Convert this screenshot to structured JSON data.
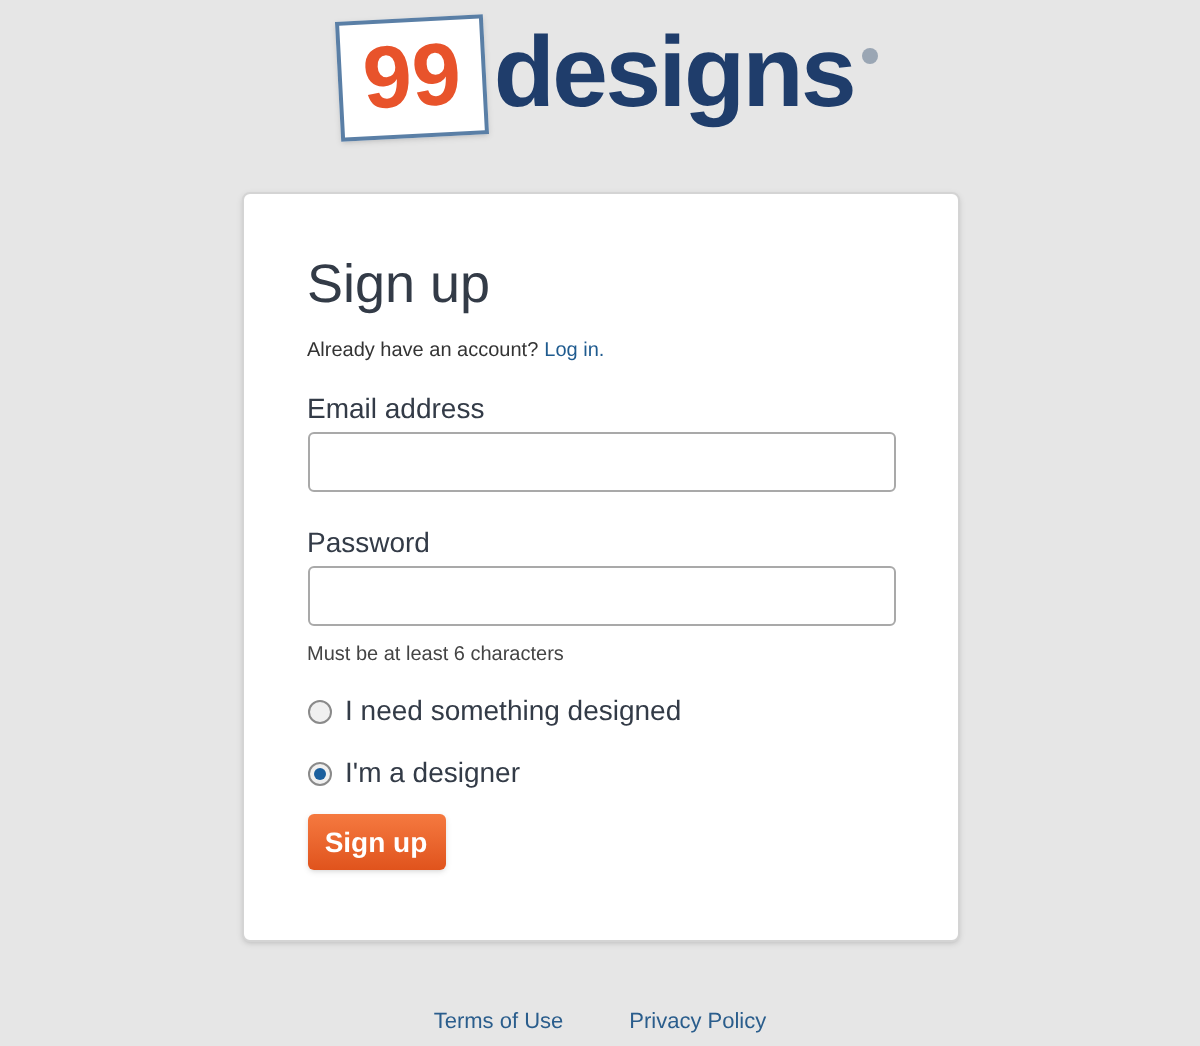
{
  "logo": {
    "number": "99",
    "word": "designs"
  },
  "form": {
    "title": "Sign up",
    "prompt": "Already have an account?",
    "login_link": "Log in.",
    "fields": [
      {
        "label": "Email address"
      },
      {
        "label": "Password",
        "hint": "Must be at least 6 characters"
      }
    ],
    "roles": [
      {
        "label": "I need something designed",
        "selected": false
      },
      {
        "label": "I'm a designer",
        "selected": true
      }
    ],
    "submit": "Sign up"
  },
  "footer": {
    "links": [
      "Terms of Use",
      "Privacy Policy"
    ]
  }
}
